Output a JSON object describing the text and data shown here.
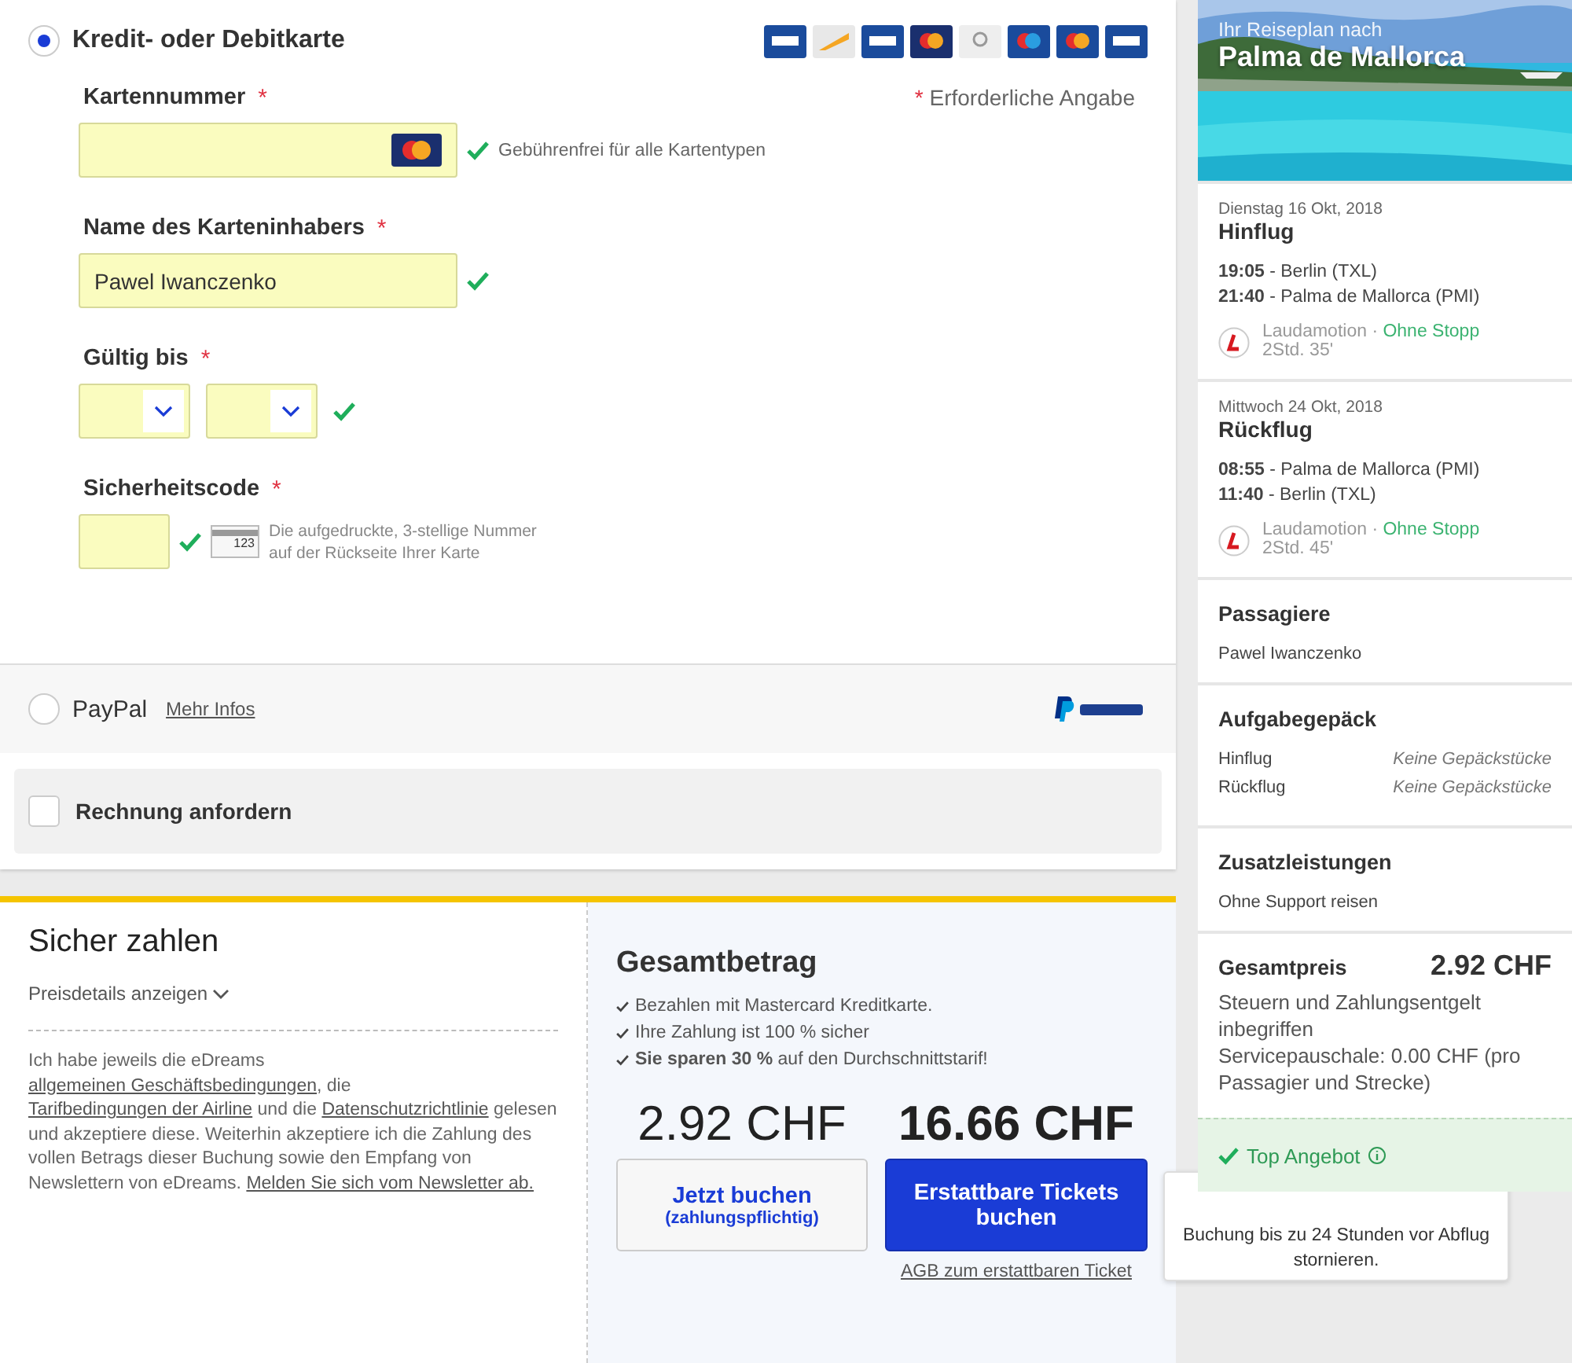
{
  "payment_methods": [
    {
      "kind": "card",
      "label": "Kredit- oder Debitkarte",
      "selected": true
    },
    {
      "kind": "paypal",
      "label": "PayPal",
      "selected": false,
      "link": "Mehr Infos"
    }
  ],
  "required_note": {
    "mark": "*",
    "text": "Erforderliche Angabe"
  },
  "form": [
    {
      "kind": "card_number",
      "label": "Kartennummer",
      "required": true,
      "valid": true,
      "hint": "Gebührenfrei für alle Kartentypen"
    },
    {
      "kind": "text",
      "label": "Name des Karteninhabers",
      "required": true,
      "valid": true,
      "value": "Pawel Iwanczenko"
    },
    {
      "kind": "expiry",
      "label": "Gültig bis",
      "required": true,
      "valid": true
    },
    {
      "kind": "cvc",
      "label": "Sicherheitscode",
      "required": true,
      "valid": true,
      "card_digits": "123",
      "hint": "Die aufgedruckte, 3-stellige Nummer auf der Rückseite Ihrer Karte"
    }
  ],
  "invoice": {
    "label": "Rechnung anfordern",
    "checked": false
  },
  "secure": {
    "title": "Sicher zahlen",
    "details_link": "Preisdetails anzeigen",
    "terms": [
      {
        "text": "Ich habe jeweils die eDreams "
      },
      {
        "text": "allgemeinen Geschäftsbedingungen",
        "link": true
      },
      {
        "text": ", die "
      },
      {
        "text": "Tarifbedingungen der Airline",
        "link": true
      },
      {
        "text": " und die "
      },
      {
        "text": "Datenschutzrichtlinie",
        "link": true
      },
      {
        "text": " gelesen und akzeptiere diese. Weiterhin akzeptiere ich die Zahlung des vollen Betrags dieser Buchung sowie den Empfang von Newslettern von eDreams. "
      },
      {
        "text": "Melden Sie sich vom Newsletter ab.",
        "link": true
      }
    ]
  },
  "total": {
    "title": "Gesamtbetrag",
    "bullets": [
      "Bezahlen mit Mastercard Kreditkarte.",
      "Ihre Zahlung ist 100 % sicher",
      "**Sie sparen 30 %** auf den Durchschnittstarif!"
    ],
    "options": [
      {
        "kind": "plain",
        "price": "2.92 CHF",
        "button": "Jetzt buchen",
        "sub": "(zahlungspflichtig)"
      },
      {
        "kind": "primary",
        "price": "16.66 CHF",
        "button": "Erstattbare Tickets buchen",
        "link": "AGB zum erstattbaren Ticket"
      }
    ]
  },
  "tooltip": {
    "lines": [
      "Buchung bis zu 24 Stunden vor Abflug",
      "stornieren."
    ]
  },
  "sidebar": {
    "subtitle": "Ihr Reiseplan nach",
    "destination": "Palma de Mallorca",
    "flights": [
      {
        "date": "Dienstag 16 Okt, 2018",
        "title": "Hinflug",
        "legs": [
          {
            "time": "19:05",
            "place": " - Berlin (TXL)"
          },
          {
            "time": "21:40",
            "place": " - Palma de Mallorca (PMI)"
          }
        ],
        "airline": "Laudamotion",
        "sep": "·",
        "stops": "Ohne Stopp",
        "duration": "2Std. 35'"
      },
      {
        "date": "Mittwoch 24 Okt, 2018",
        "title": "Rückflug",
        "legs": [
          {
            "time": "08:55",
            "place": " - Palma de Mallorca (PMI)"
          },
          {
            "time": "11:40",
            "place": " - Berlin (TXL)"
          }
        ],
        "airline": "Laudamotion",
        "sep": "·",
        "stops": "Ohne Stopp",
        "duration": "2Std. 45'"
      }
    ],
    "passengers": {
      "title": "Passagiere",
      "names": [
        "Pawel Iwanczenko"
      ]
    },
    "baggage": {
      "title": "Aufgabegepäck",
      "rows": [
        {
          "leg": "Hinflug",
          "value": "Keine Gepäckstücke"
        },
        {
          "leg": "Rückflug",
          "value": "Keine Gepäckstücke"
        }
      ]
    },
    "extras": {
      "title": "Zusatzleistungen",
      "items": [
        "Ohne Support reisen"
      ]
    },
    "price": {
      "label": "Gesamtpreis",
      "amount": "2.92 CHF",
      "notes": [
        "Steuern und Zahlungsentgelt inbegriffen",
        "Servicepauschale: 0.00 CHF (pro Passagier und Strecke)"
      ]
    },
    "offer": {
      "label": "Top Angebot"
    }
  }
}
